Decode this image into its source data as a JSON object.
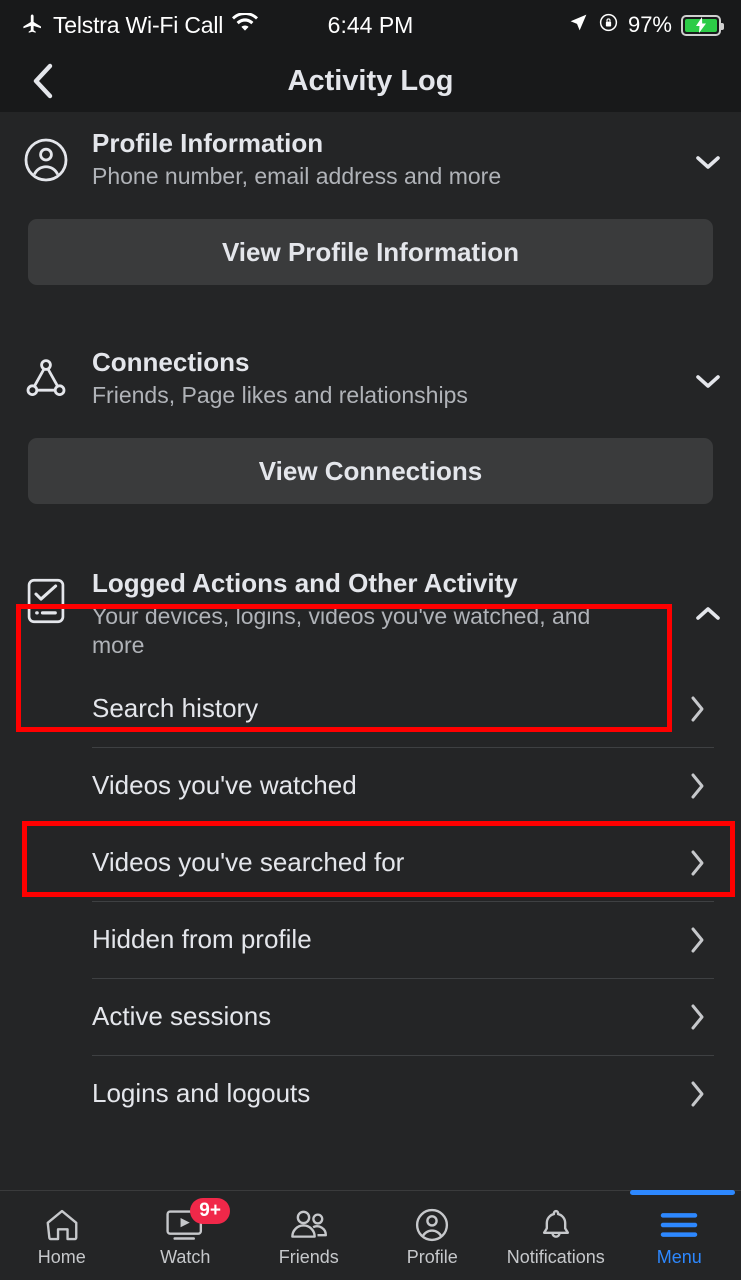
{
  "status_bar": {
    "airplane_icon": "airplane-icon",
    "carrier": "Telstra Wi-Fi Call",
    "wifi_icon": "wifi-icon",
    "time": "6:44 PM",
    "location_icon": "location-arrow-icon",
    "rotation_lock_icon": "rotation-lock-icon",
    "battery_percent": "97%",
    "battery_charging": true,
    "battery_color": "#2ccc47"
  },
  "header": {
    "back_icon": "chevron-left-icon",
    "title": "Activity Log"
  },
  "sections": [
    {
      "icon": "profile-person-icon",
      "title": "Profile Information",
      "subtitle": "Phone number, email address and more",
      "chevron": "chevron-down-icon",
      "button_label": "View Profile Information"
    },
    {
      "icon": "connections-network-icon",
      "title": "Connections",
      "subtitle": "Friends, Page likes and relationships",
      "chevron": "chevron-down-icon",
      "button_label": "View Connections"
    },
    {
      "icon": "checklist-clipboard-icon",
      "title": "Logged Actions and Other Activity",
      "subtitle": "Your devices, logins, videos you've watched, and more",
      "chevron": "chevron-up-icon"
    }
  ],
  "logged_actions_items": [
    {
      "label": "Search history",
      "chevron": "chevron-right-icon"
    },
    {
      "label": "Videos you've watched",
      "chevron": "chevron-right-icon"
    },
    {
      "label": "Videos you've searched for",
      "chevron": "chevron-right-icon"
    },
    {
      "label": "Hidden from profile",
      "chevron": "chevron-right-icon"
    },
    {
      "label": "Active sessions",
      "chevron": "chevron-right-icon"
    },
    {
      "label": "Logins and logouts",
      "chevron": "chevron-right-icon"
    }
  ],
  "annotations": {
    "highlight_color": "#ff0000",
    "boxes": [
      {
        "target": "Logged Actions and Other Activity"
      },
      {
        "target": "Videos you've watched"
      }
    ]
  },
  "tabbar": {
    "active_color": "#2d88ff",
    "badge_color": "#f02849",
    "tabs": [
      {
        "label": "Home",
        "icon": "home-icon",
        "badge": "",
        "active": false
      },
      {
        "label": "Watch",
        "icon": "watch-video-icon",
        "badge": "9+",
        "active": false
      },
      {
        "label": "Friends",
        "icon": "friends-people-icon",
        "badge": "",
        "active": false
      },
      {
        "label": "Profile",
        "icon": "profile-avatar-icon",
        "badge": "",
        "active": false
      },
      {
        "label": "Notifications",
        "icon": "bell-icon",
        "badge": "",
        "active": false
      },
      {
        "label": "Menu",
        "icon": "hamburger-menu-icon",
        "badge": "",
        "active": true
      }
    ]
  }
}
